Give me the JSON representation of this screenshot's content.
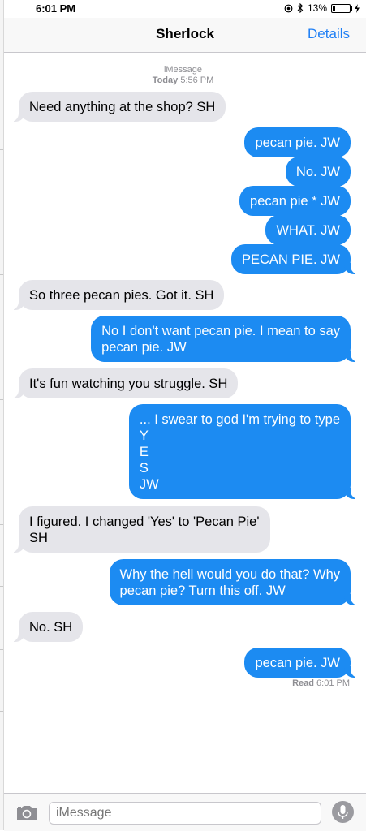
{
  "status": {
    "time": "6:01 PM",
    "battery": "13%",
    "battery_level": 0.13
  },
  "nav": {
    "title": "Sherlock",
    "details": "Details"
  },
  "header_meta": {
    "service": "iMessage",
    "day": "Today",
    "time": "5:56 PM"
  },
  "messages": [
    {
      "text": "Need anything at the shop? SH",
      "from": "contact"
    },
    {
      "text": "pecan pie. JW",
      "from": "me"
    },
    {
      "text": "No. JW",
      "from": "me"
    },
    {
      "text": "pecan pie * JW",
      "from": "me"
    },
    {
      "text": "WHAT. JW",
      "from": "me"
    },
    {
      "text": "PECAN PIE. JW",
      "from": "me"
    },
    {
      "text": "So three pecan pies. Got it. SH",
      "from": "contact"
    },
    {
      "text": "No I don't want pecan pie. I mean to say\npecan pie. JW",
      "from": "me"
    },
    {
      "text": "It's fun watching you struggle. SH",
      "from": "contact"
    },
    {
      "text": "... I swear to god I'm trying to type\nY\nE\nS\nJW",
      "from": "me"
    },
    {
      "text": "I figured. I changed 'Yes' to 'Pecan Pie'\nSH",
      "from": "contact"
    },
    {
      "text": "Why the hell would you do that? Why\npecan pie? Turn this off. JW",
      "from": "me"
    },
    {
      "text": "No. SH",
      "from": "contact"
    },
    {
      "text": "pecan pie. JW",
      "from": "me"
    }
  ],
  "read_receipt": {
    "label": "Read",
    "time": "6:01 PM"
  },
  "composer": {
    "placeholder": "iMessage"
  },
  "icons": [
    "camera-icon",
    "microphone-icon",
    "bluetooth-icon",
    "location-icon",
    "battery-icon",
    "charging-icon"
  ],
  "colors": {
    "outgoing": "#1c8bf2",
    "incoming": "#e5e5ea",
    "accent": "#1f7ff5"
  }
}
